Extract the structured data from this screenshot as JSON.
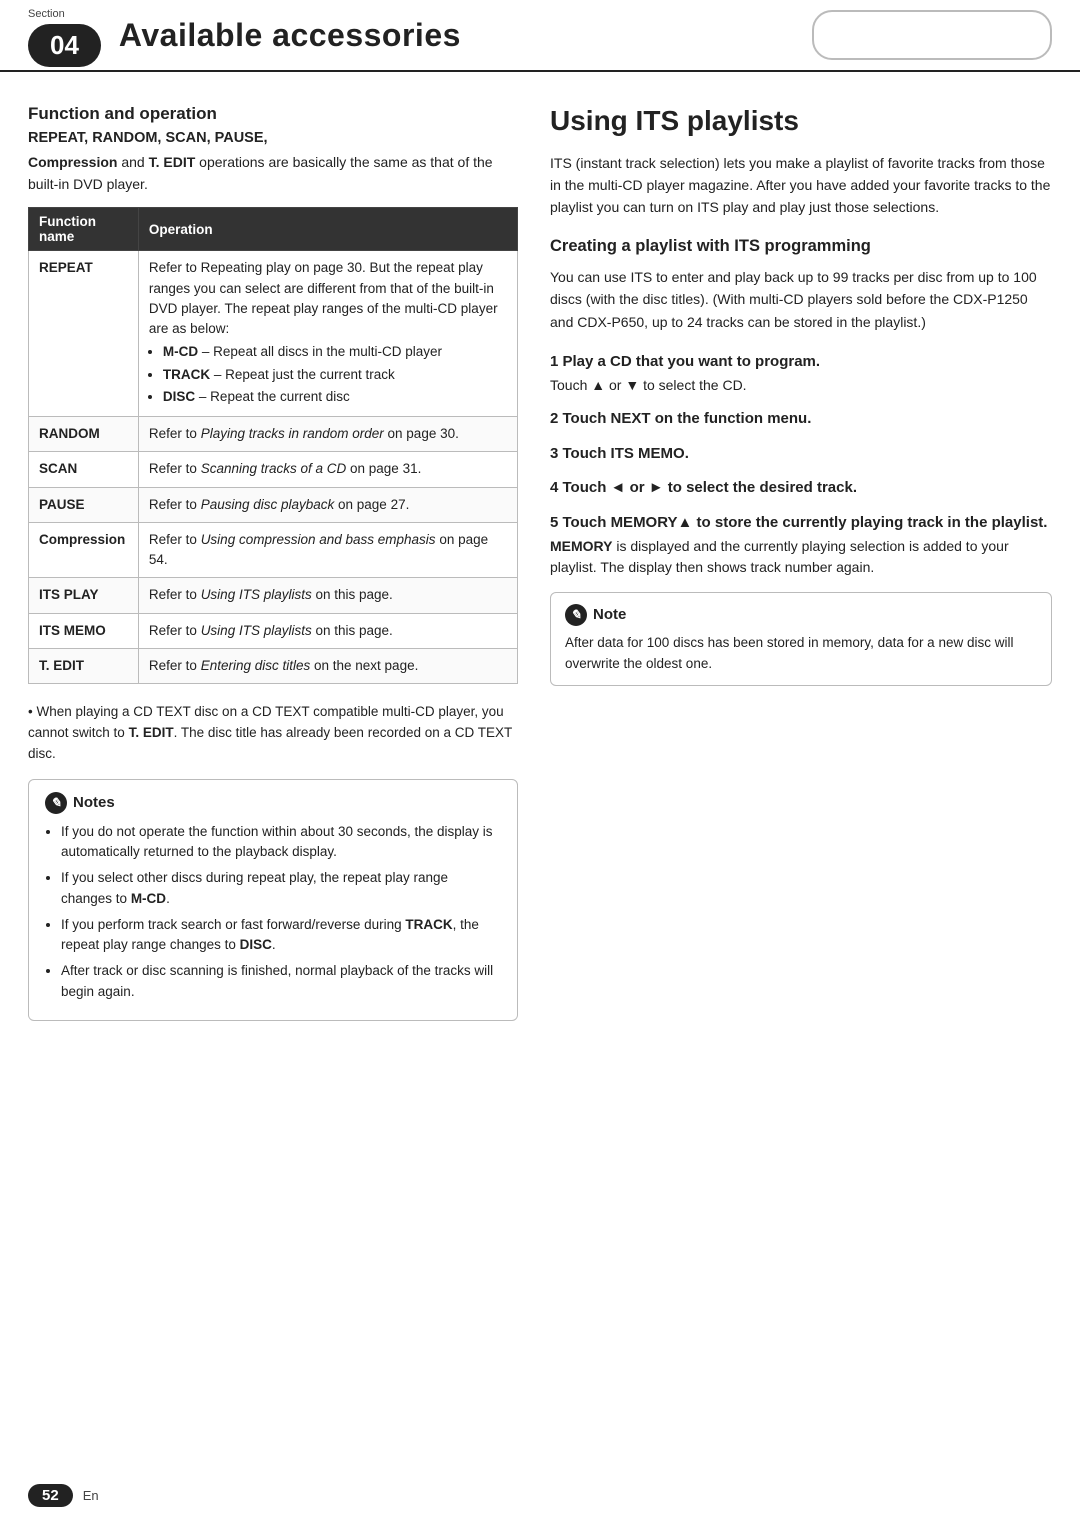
{
  "header": {
    "section_label": "Section",
    "chapter_num": "04",
    "title": "Available accessories",
    "right_box_placeholder": ""
  },
  "left": {
    "func_op_heading": "Function and operation",
    "func_op_keywords": "REPEAT, RANDOM, SCAN, PAUSE,",
    "func_op_intro": "Compression and T. EDIT operations are basically the same as that of the built-in DVD player.",
    "table": {
      "col1": "Function name",
      "col2": "Operation",
      "rows": [
        {
          "name": "REPEAT",
          "op_text": "Refer to Repeating play on page 30. But the repeat play ranges you can select are different from that of the built-in DVD player. The repeat play ranges of the multi-CD player are as below:",
          "bullets": [
            "M-CD – Repeat all discs in the multi-CD player",
            "TRACK – Repeat just the current track",
            "DISC – Repeat the current disc"
          ]
        },
        {
          "name": "RANDOM",
          "op_text": "Refer to Playing tracks in random order on page 30.",
          "op_italic": "Playing tracks in random order",
          "op_page": "page 30.",
          "bullets": []
        },
        {
          "name": "SCAN",
          "op_text": "Refer to Scanning tracks of a CD on page 31.",
          "op_italic": "Scanning tracks of a CD",
          "op_page": "page 31.",
          "bullets": []
        },
        {
          "name": "PAUSE",
          "op_text": "Refer to Pausing disc playback on page 27.",
          "op_italic": "Pausing disc playback",
          "op_page": "page 27.",
          "bullets": []
        },
        {
          "name": "Compression",
          "op_text": "Refer to Using compression and bass emphasis on page 54.",
          "op_italic": "Using compression and bass emphasis",
          "op_page": "page 54.",
          "bullets": []
        },
        {
          "name": "ITS PLAY",
          "op_text": "Refer to Using ITS playlists on this page.",
          "op_italic": "Using ITS playlists",
          "bullets": []
        },
        {
          "name": "ITS MEMO",
          "op_text": "Refer to Using ITS playlists on this page.",
          "op_italic": "Using ITS playlists",
          "bullets": []
        },
        {
          "name": "T. EDIT",
          "op_text": "Refer to Entering disc titles on the next page.",
          "op_italic": "Entering disc titles",
          "bullets": []
        }
      ]
    },
    "notes_heading": "Notes",
    "notes": [
      "If you do not operate the function within about 30 seconds, the display is automatically returned to the playback display.",
      "If you select other discs during repeat play, the repeat play range changes to M-CD.",
      "If you perform track search or fast forward/reverse during TRACK, the repeat play range changes to DISC.",
      "After track or disc scanning is finished, normal playback of the tracks will begin again."
    ],
    "right_note_text": "When playing a CD TEXT disc on a CD TEXT compatible multi-CD player, you cannot switch to T. EDIT. The disc title has already been recorded on a CD TEXT disc."
  },
  "right": {
    "its_title": "Using ITS playlists",
    "its_intro": "ITS (instant track selection) lets you make a playlist of favorite tracks from those in the multi-CD player magazine. After you have added your favorite tracks to the playlist you can turn on ITS play and play just those selections.",
    "creating_heading": "Creating a playlist with ITS programming",
    "creating_intro": "You can use ITS to enter and play back up to 99 tracks per disc from up to 100 discs (with the disc titles). (With multi-CD players sold before the CDX-P1250 and CDX-P650, up to 24 tracks can be stored in the playlist.)",
    "steps": [
      {
        "num": "1",
        "label": "Play a CD that you want to program.",
        "sub": "Touch ▲ or ▼ to select the CD."
      },
      {
        "num": "2",
        "label": "Touch NEXT on the function menu.",
        "sub": ""
      },
      {
        "num": "3",
        "label": "Touch ITS MEMO.",
        "sub": ""
      },
      {
        "num": "4",
        "label": "Touch ◄ or ► to select the desired track.",
        "sub": ""
      },
      {
        "num": "5",
        "label": "Touch MEMORY▲ to store the currently playing track in the playlist.",
        "sub": "MEMORY is displayed and the currently playing selection is added to your playlist. The display then shows track number again."
      }
    ],
    "note_heading": "Note",
    "note_text": "After data for 100 discs has been stored in memory, data for a new disc will overwrite the oldest one."
  },
  "footer": {
    "page_num": "52",
    "lang": "En"
  }
}
